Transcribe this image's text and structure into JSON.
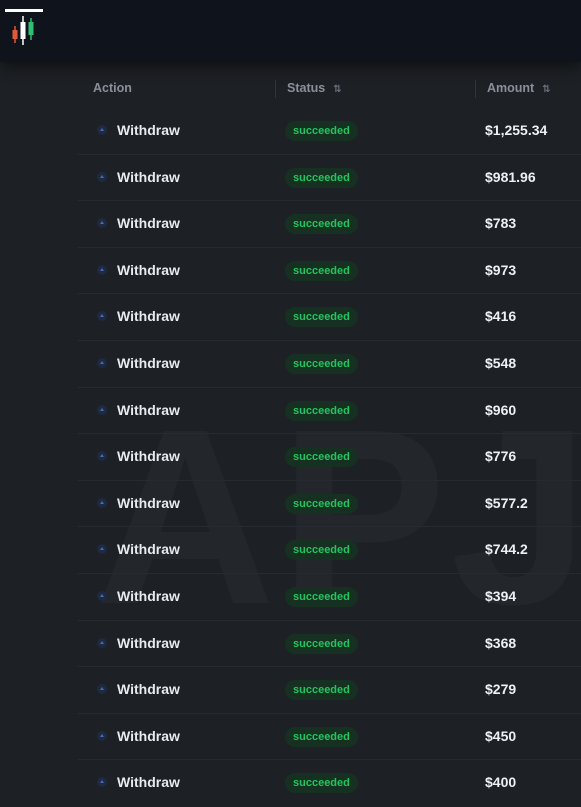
{
  "app": {
    "watermark_text": "APJ",
    "colors": {
      "background": "#1d2025",
      "topbar": "#0f141c",
      "success_text": "#22c55e",
      "success_bg": "#163022",
      "action_icon": "#4d6aa8"
    },
    "logo_icon": "candlestick-logo-icon"
  },
  "table": {
    "columns": {
      "action": "Action",
      "status": "Status",
      "amount": "Amount"
    },
    "sort_icon": "⇅",
    "rows": [
      {
        "action": "Withdraw",
        "status": "succeeded",
        "amount": "$1,255.34"
      },
      {
        "action": "Withdraw",
        "status": "succeeded",
        "amount": "$981.96"
      },
      {
        "action": "Withdraw",
        "status": "succeeded",
        "amount": "$783"
      },
      {
        "action": "Withdraw",
        "status": "succeeded",
        "amount": "$973"
      },
      {
        "action": "Withdraw",
        "status": "succeeded",
        "amount": "$416"
      },
      {
        "action": "Withdraw",
        "status": "succeeded",
        "amount": "$548"
      },
      {
        "action": "Withdraw",
        "status": "succeeded",
        "amount": "$960"
      },
      {
        "action": "Withdraw",
        "status": "succeeded",
        "amount": "$776"
      },
      {
        "action": "Withdraw",
        "status": "succeeded",
        "amount": "$577.2"
      },
      {
        "action": "Withdraw",
        "status": "succeeded",
        "amount": "$744.2"
      },
      {
        "action": "Withdraw",
        "status": "succeeded",
        "amount": "$394"
      },
      {
        "action": "Withdraw",
        "status": "succeeded",
        "amount": "$368"
      },
      {
        "action": "Withdraw",
        "status": "succeeded",
        "amount": "$279"
      },
      {
        "action": "Withdraw",
        "status": "succeeded",
        "amount": "$450"
      },
      {
        "action": "Withdraw",
        "status": "succeeded",
        "amount": "$400"
      }
    ]
  }
}
